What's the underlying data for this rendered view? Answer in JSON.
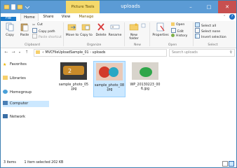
{
  "window": {
    "title": "uploads",
    "contextual_tab": "Picture Tools"
  },
  "tabs": {
    "file": "File",
    "home": "Home",
    "share": "Share",
    "view": "View",
    "manage": "Manage"
  },
  "ribbon": {
    "clipboard": {
      "label": "Clipboard",
      "copy": "Copy",
      "paste": "Paste",
      "cut": "Cut",
      "copy_path": "Copy path",
      "paste_shortcut": "Paste shortcut"
    },
    "organize": {
      "label": "Organize",
      "move_to": "Move to",
      "copy_to": "Copy to",
      "delete": "Delete",
      "rename": "Rename"
    },
    "new": {
      "label": "New",
      "new_folder": "New folder"
    },
    "open": {
      "label": "Open",
      "properties": "Properties",
      "open": "Open",
      "edit": "Edit",
      "history": "History"
    },
    "select": {
      "label": "Select",
      "select_all": "Select all",
      "select_none": "Select none",
      "invert_selection": "Invert selection"
    }
  },
  "address": {
    "root": "MVCFileUploadSample_01",
    "current": "uploads",
    "search_placeholder": "Search uploads"
  },
  "nav": {
    "items": [
      "Favorites",
      "Libraries",
      "Homegroup",
      "Computer",
      "Network"
    ]
  },
  "files": [
    {
      "name_line1": "sample_photo_05",
      "name_line2": ".jpg"
    },
    {
      "name_line1": "sample_photo_08",
      "name_line2": ".jpg"
    },
    {
      "name_line1": "WP_20130223_00",
      "name_line2": "6.jpg"
    }
  ],
  "status": {
    "items": "3 items",
    "selected": "1 item selected  202 KB"
  },
  "colors": {
    "titlebar": "#5b9bd5",
    "file_tab": "#1979ca",
    "contextual": "#f4d96b",
    "selection": "#cce8ff"
  }
}
